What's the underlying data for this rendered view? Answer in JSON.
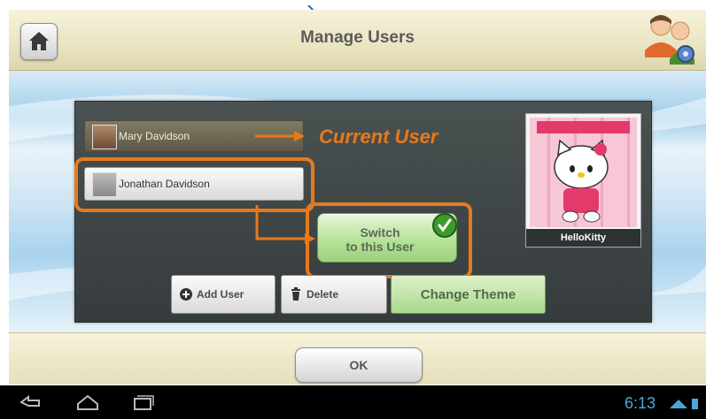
{
  "titlebar": {
    "title": "Manage Users"
  },
  "users": [
    {
      "name": "Mary Davidson",
      "state": "current"
    },
    {
      "name": "Jonathan Davidson",
      "state": "selected"
    }
  ],
  "annotations": {
    "current_user": "Current User",
    "highlight_color": "#e8791b"
  },
  "switch_button": {
    "label_line1": "Switch",
    "label_line2": "to this User"
  },
  "theme": {
    "name": "HelloKitty"
  },
  "toolbar": {
    "add_user": "Add User",
    "delete": "Delete",
    "change_theme": "Change Theme"
  },
  "dialog": {
    "ok": "OK"
  },
  "statusbar": {
    "time": "6:13"
  },
  "icons": [
    "home-icon",
    "users-gear-icon",
    "checkmark-icon",
    "add-icon",
    "trash-icon",
    "back-icon",
    "home-nav-icon",
    "recent-apps-icon",
    "wifi-icon",
    "battery-icon"
  ]
}
